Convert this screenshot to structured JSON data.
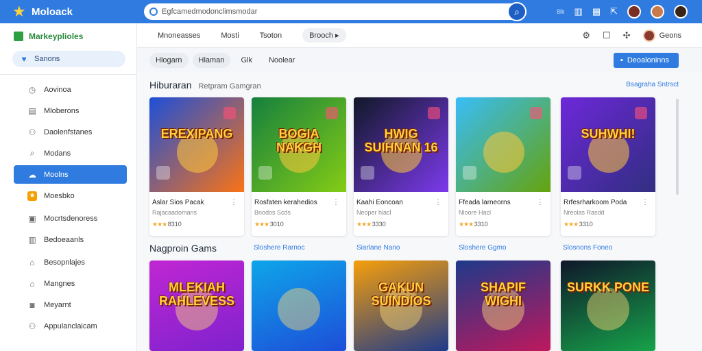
{
  "app": {
    "name": "Moloack",
    "search_value": "Egfcamedmodonclimsmodar"
  },
  "top": {
    "badge": "8lk"
  },
  "sidebar": {
    "brand": "Markeyplioles",
    "search_label": "Sanons",
    "items": [
      {
        "label": "Aovinoa",
        "icon": "clock-icon",
        "glyph": "◷"
      },
      {
        "label": "Mloberons",
        "icon": "list-icon",
        "glyph": "▤"
      },
      {
        "label": "Daolenfstanes",
        "icon": "user-icon",
        "glyph": "⚇"
      },
      {
        "label": "Modans",
        "icon": "search-icon",
        "glyph": "⌕"
      },
      {
        "label": "Moolns",
        "icon": "cloud-icon",
        "glyph": "☁",
        "active": true
      },
      {
        "label": "Moesbko",
        "icon": "game-icon",
        "glyph": "★",
        "colored": true
      },
      {
        "label": "Mocrtsdenoress",
        "icon": "monitor-icon",
        "glyph": "▣"
      },
      {
        "label": "Bedoeaanls",
        "icon": "document-icon",
        "glyph": "▥"
      },
      {
        "label": "Besopnlajes",
        "icon": "home-icon",
        "glyph": "⌂"
      },
      {
        "label": "Mangnes",
        "icon": "building-icon",
        "glyph": "⌂"
      },
      {
        "label": "Meyarnt",
        "icon": "chat-icon",
        "glyph": "◙"
      },
      {
        "label": "Appulanclaicam",
        "icon": "people-icon",
        "glyph": "⚇"
      }
    ]
  },
  "subnav": {
    "tabs": [
      "Mnoneasses",
      "Mosti",
      "Tsoton",
      "Brooch"
    ],
    "user_label": "Geons"
  },
  "filters": {
    "chips": [
      "Hlogarn",
      "Hlaman",
      "Glk",
      "Noolear"
    ],
    "button_label": "Deoaloninns"
  },
  "section1": {
    "title": "Hiburaran",
    "subtitle": "Retpram Gamgran",
    "link": "Bsagraha Sntrsct",
    "cards": [
      {
        "art_text": "EREXIPANG",
        "title": "Aslar Sios Pacak",
        "sub": "Rajacaadomans",
        "rating": "8310",
        "colors": [
          "#1d4fd8",
          "#f97316"
        ]
      },
      {
        "art_text": "BOGIA NAKGH",
        "title": "Rosfaten kerahedios",
        "sub": "Bnodos Scds",
        "rating": "3010",
        "colors": [
          "#15803d",
          "#84cc16"
        ]
      },
      {
        "art_text": "HWIG SUIHNAN 16",
        "title": "Kaahi Eoncoan",
        "sub": "Neoper hlacl",
        "rating": "3330",
        "colors": [
          "#111827",
          "#7c3aed"
        ]
      },
      {
        "art_text": "",
        "title": "Ffeada larneorns",
        "sub": "Nloore Hacl",
        "rating": "3310",
        "colors": [
          "#38bdf8",
          "#65a30d"
        ]
      },
      {
        "art_text": "SUHWHI!",
        "title": "Rrfesrharkoom Poda",
        "sub": "Nreolas Rasdd",
        "rating": "3310",
        "colors": [
          "#6d28d9",
          "#312e81"
        ]
      }
    ]
  },
  "section2": {
    "title": "Nagproin Gams",
    "links": [
      "Sloshere Rarnoc",
      "Siarlane Nano",
      "Sloshere Ggmo",
      "Slosnons Foneo"
    ],
    "cards": [
      {
        "art_text": "MLEKIAH RAHLEVESS",
        "colors": [
          "#c026d3",
          "#7e22ce"
        ]
      },
      {
        "art_text": "",
        "colors": [
          "#0ea5e9",
          "#1d4ed8"
        ]
      },
      {
        "art_text": "GAKUN SUINDIOS",
        "colors": [
          "#f59e0b",
          "#1e3a8a"
        ]
      },
      {
        "art_text": "SHAPIF WIGHI",
        "colors": [
          "#1e3a8a",
          "#be185d"
        ]
      },
      {
        "art_text": "SURKK PONE",
        "colors": [
          "#0f172a",
          "#16a34a"
        ]
      }
    ]
  }
}
